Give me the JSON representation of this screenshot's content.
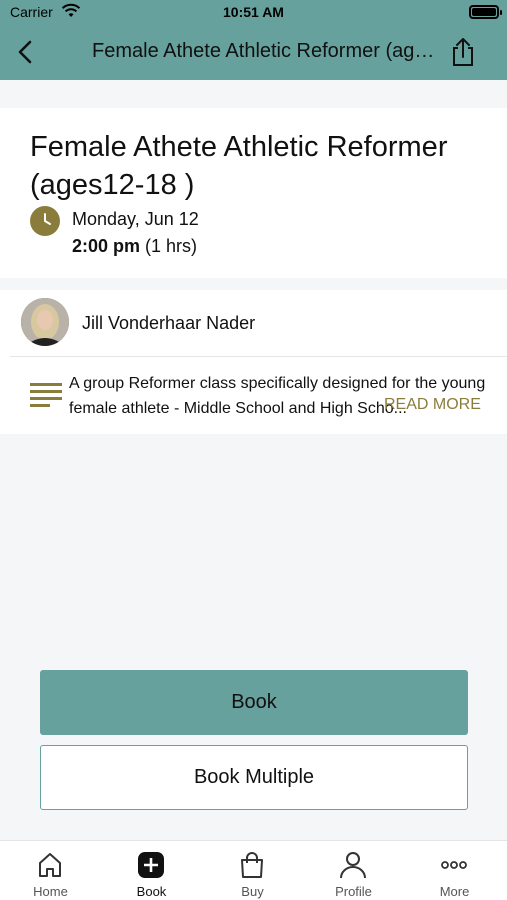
{
  "status_bar": {
    "carrier": "Carrier",
    "time": "10:51 AM"
  },
  "nav": {
    "title": "Female Athete Athletic Reformer (ages12-18 )"
  },
  "class": {
    "title": "Female Athete Athletic Reformer (ages12-18 )",
    "date": "Monday, Jun 12",
    "time_bold": "2:00 pm",
    "duration": " (1 hrs)"
  },
  "instructor": {
    "name": "Jill Vonderhaar Nader"
  },
  "description": {
    "text": "A group Reformer class specifically designed for the young female athlete - Middle School and High Scho...",
    "read_more": "READ MORE"
  },
  "actions": {
    "book": "Book",
    "book_multiple": "Book Multiple"
  },
  "tabs": [
    {
      "label": "Home",
      "icon": "home-icon"
    },
    {
      "label": "Book",
      "icon": "plus-square-icon"
    },
    {
      "label": "Buy",
      "icon": "shopping-bag-icon"
    },
    {
      "label": "Profile",
      "icon": "person-icon"
    },
    {
      "label": "More",
      "icon": "more-dots-icon"
    }
  ],
  "colors": {
    "accent": "#66a19d",
    "gold": "#8a7d3b"
  }
}
